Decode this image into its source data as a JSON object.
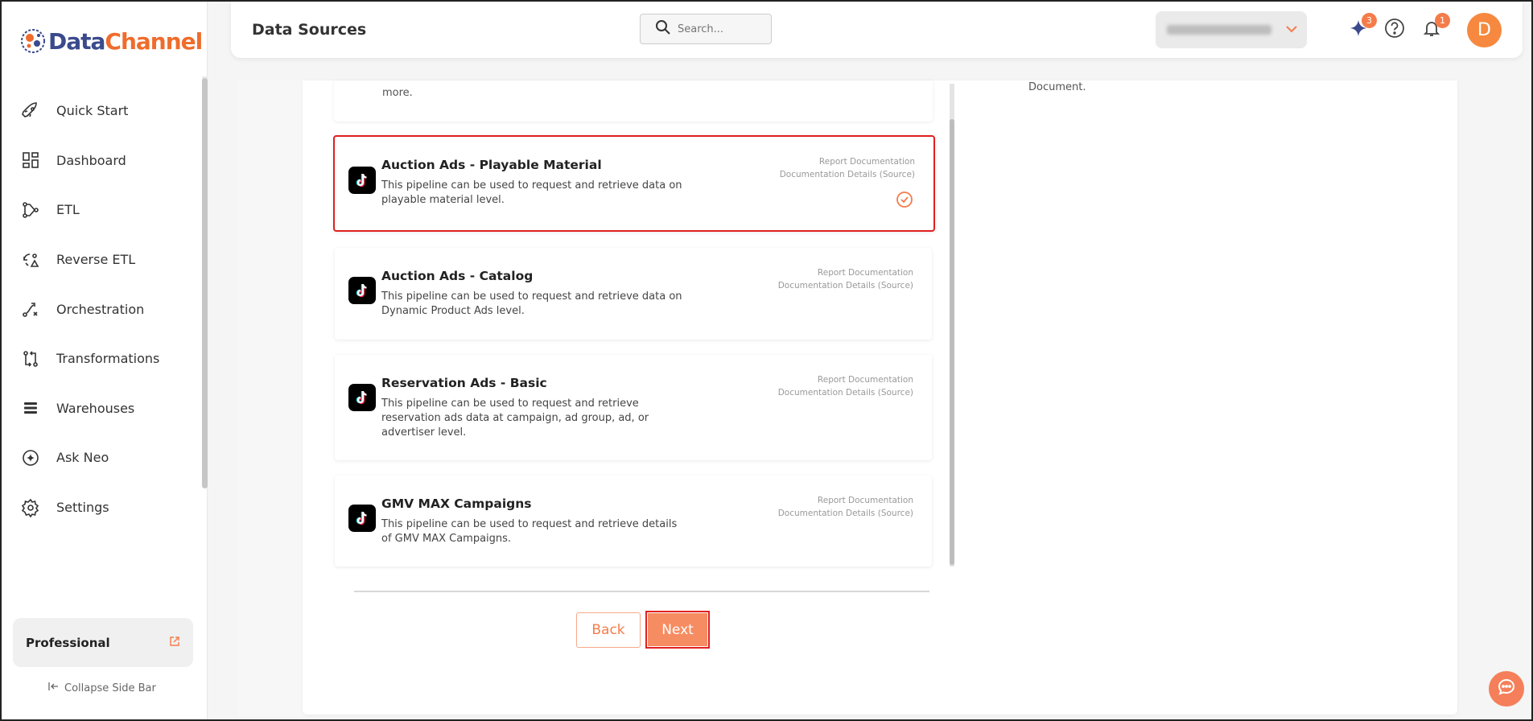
{
  "app": {
    "brand_part1": "Data",
    "brand_part2": "Channel"
  },
  "colors": {
    "accent": "#f47c4a",
    "brand_blue": "#3a4a8c",
    "selected_border": "#e02020"
  },
  "sidebar": {
    "items": [
      {
        "label": "Quick Start",
        "icon": "rocket-icon"
      },
      {
        "label": "Dashboard",
        "icon": "dashboard-icon"
      },
      {
        "label": "ETL",
        "icon": "etl-icon"
      },
      {
        "label": "Reverse ETL",
        "icon": "reverse-etl-icon"
      },
      {
        "label": "Orchestration",
        "icon": "orchestration-icon"
      },
      {
        "label": "Transformations",
        "icon": "transformations-icon"
      },
      {
        "label": "Warehouses",
        "icon": "warehouses-icon"
      },
      {
        "label": "Ask Neo",
        "icon": "sparkle-icon"
      },
      {
        "label": "Settings",
        "icon": "gear-icon"
      }
    ],
    "plan_label": "Professional",
    "collapse_label": "Collapse Side Bar"
  },
  "header": {
    "title": "Data Sources",
    "search_placeholder": "Search...",
    "neo_badge": "3",
    "notification_badge": "1",
    "avatar_initial": "D"
  },
  "main": {
    "top_fragment_text": "more.",
    "right_doc_text": "Document.",
    "pipelines": [
      {
        "title": "Auction Ads - Playable Material",
        "description": "This pipeline can be used to request and retrieve data on playable material level.",
        "link1": "Report Documentation",
        "link2": "Documentation Details (Source)",
        "selected": true
      },
      {
        "title": "Auction Ads - Catalog",
        "description": "This pipeline can be used to request and retrieve data on Dynamic Product Ads level.",
        "link1": "Report Documentation",
        "link2": "Documentation Details (Source)",
        "selected": false
      },
      {
        "title": "Reservation Ads - Basic",
        "description": "This pipeline can be used to request and retrieve reservation ads data at campaign, ad group, ad, or advertiser level.",
        "link1": "Report Documentation",
        "link2": "Documentation Details (Source)",
        "selected": false
      },
      {
        "title": "GMV MAX Campaigns",
        "description": "This pipeline can be used to request and retrieve details of GMV MAX Campaigns.",
        "link1": "Report Documentation",
        "link2": "Documentation Details (Source)",
        "selected": false
      }
    ],
    "back_label": "Back",
    "next_label": "Next"
  }
}
